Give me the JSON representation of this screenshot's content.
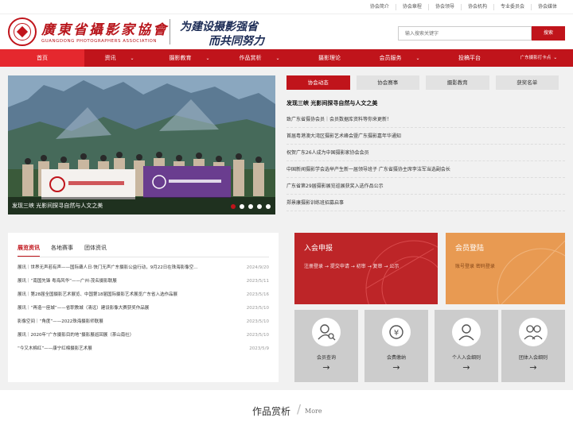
{
  "topbar": {
    "links": [
      "协会简介",
      "协会章程",
      "协会领导",
      "协会机构",
      "专业委员会",
      "协会媒体"
    ]
  },
  "header": {
    "logo_cn": "廣東省攝影家協會",
    "logo_en": "GUANGDONG  PHOTOGRAPHERS  ASSOCIATION",
    "slogan_line1": "为建设摄影强省",
    "slogan_line2": "而共同努力"
  },
  "search": {
    "placeholder": "输入搜索关键字",
    "button": "搜索"
  },
  "nav": [
    {
      "label": "首页",
      "chev": ""
    },
    {
      "label": "资讯",
      "chev": "⌄"
    },
    {
      "label": "摄影教育",
      "chev": "⌄"
    },
    {
      "label": "作品赏析",
      "chev": "⌄"
    },
    {
      "label": "摄影理论",
      "chev": ""
    },
    {
      "label": "会员服务",
      "chev": "⌄"
    },
    {
      "label": "投稿平台",
      "chev": ""
    },
    {
      "label": "广东摄影打卡点",
      "chev": "⌄"
    }
  ],
  "banner": {
    "caption": "发现三峡 光影间探寻自然与人文之美",
    "dots": 5,
    "active_dot": 1
  },
  "news": {
    "tabs": [
      "协会动态",
      "协会赛事",
      "摄影教育",
      "获奖名单"
    ],
    "headline": "发现三峡 光影间探寻自然与人文之美",
    "items": [
      "致广东省摄协会员｜会员数据库资料等你来更新！",
      "首届粤港澳大湾区摄影艺术峰会暨广东摄影嘉年华通知",
      "祝贺广东26人成为中国摄影家协会会员",
      "中国新闻摄影学会选举产生新一届领导班子 广东省摄协主席李洁军当选副会长",
      "广东省第29届摄影展览巡展获奖入选作品公示",
      "郑景康摄影训练班招募启事"
    ]
  },
  "exhibitions": {
    "tabs": [
      "展览资讯",
      "各地赛事",
      "团体资讯"
    ],
    "items": [
      {
        "title": "展讯｜世界无声若有声——国际聋人日·快门无声广东摄影公益行动，9月22日在珠海影像空...",
        "date": "2024/9/20"
      },
      {
        "title": "展讯｜“南国先锋 粤海风华”——广州·茂名摄影联展",
        "date": "2023/5/11"
      },
      {
        "title": "展讯｜第28届全国摄影艺术展览、中国第18届国际摄影艺术展览广东省入选作品展",
        "date": "2023/5/16"
      },
      {
        "title": "展讯｜“再造一座城”——省职教城（清远）建设影像大赛获奖作品展",
        "date": "2023/5/10"
      },
      {
        "title": "影像空间｜“角度”——2022珠海摄影师联展",
        "date": "2023/5/10"
      },
      {
        "title": "展讯｜2020年“广东摄影目的地”摄影展巡回展（茶山南社）",
        "date": "2023/5/10"
      },
      {
        "title": "“今又木棉红”——康宁红棉摄影艺术展",
        "date": "2023/5/9"
      }
    ]
  },
  "cards": {
    "join": {
      "title": "入会申报",
      "steps": "注册登录 → 提交申请 → 初审 → 复审 → 公示"
    },
    "login": {
      "title": "会员登陆",
      "sub": "账号登录  密码登录"
    }
  },
  "services": [
    {
      "label": "会员查询",
      "icon": "user-search-icon"
    },
    {
      "label": "会费缴纳",
      "icon": "fee-icon"
    },
    {
      "label": "个人入会细则",
      "icon": "person-icon"
    },
    {
      "label": "团体入会细则",
      "icon": "group-icon"
    }
  ],
  "works": {
    "title": "作品赏析",
    "sep": "/",
    "more": "More"
  },
  "colors": {
    "brand_red": "#c0141b",
    "orange": "#e89a52"
  }
}
